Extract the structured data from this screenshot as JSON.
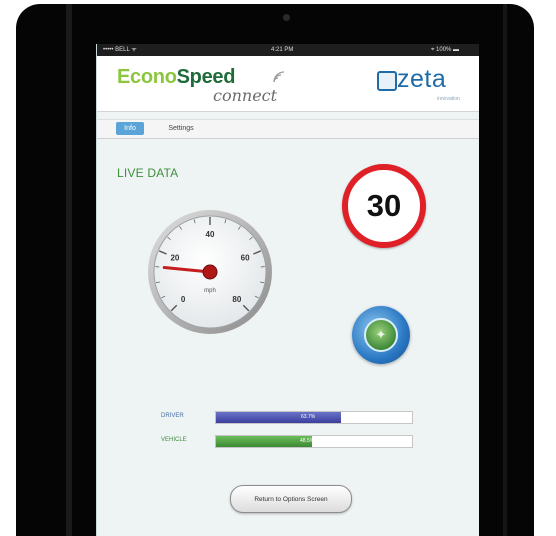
{
  "statusbar": {
    "carrier": "••••• BELL ᯤ",
    "time": "4:21 PM",
    "battery": "⌖ 100% ▬"
  },
  "header": {
    "logo_econo": "Econo",
    "logo_speed": "Speed",
    "logo_connect": "connect",
    "logo_zeta": "zeta",
    "zeta_tagline": "innovation"
  },
  "tabs": [
    {
      "label": "Info",
      "active": true
    },
    {
      "label": "Settings",
      "active": false
    }
  ],
  "main": {
    "section_title": "LIVE DATA",
    "speed_limit": "30",
    "gauge": {
      "unit": "mph",
      "tick_labels": [
        "0",
        "20",
        "40",
        "60",
        "80"
      ],
      "needle_value": 15,
      "max": 80
    },
    "bars": [
      {
        "label": "DRIVER",
        "fraction": 0.64,
        "value": "63.7%"
      },
      {
        "label": "VEHICLE",
        "fraction": 0.49,
        "value": "48.5%"
      }
    ],
    "return_button": "Return to Options Screen"
  },
  "colors": {
    "speed_sign_ring": "#e02027",
    "accent_tab": "#5aa4d8",
    "driver_bar": "#3a3f9c",
    "vehicle_bar": "#3c8a34",
    "live_data_text": "#3f8f3f"
  }
}
